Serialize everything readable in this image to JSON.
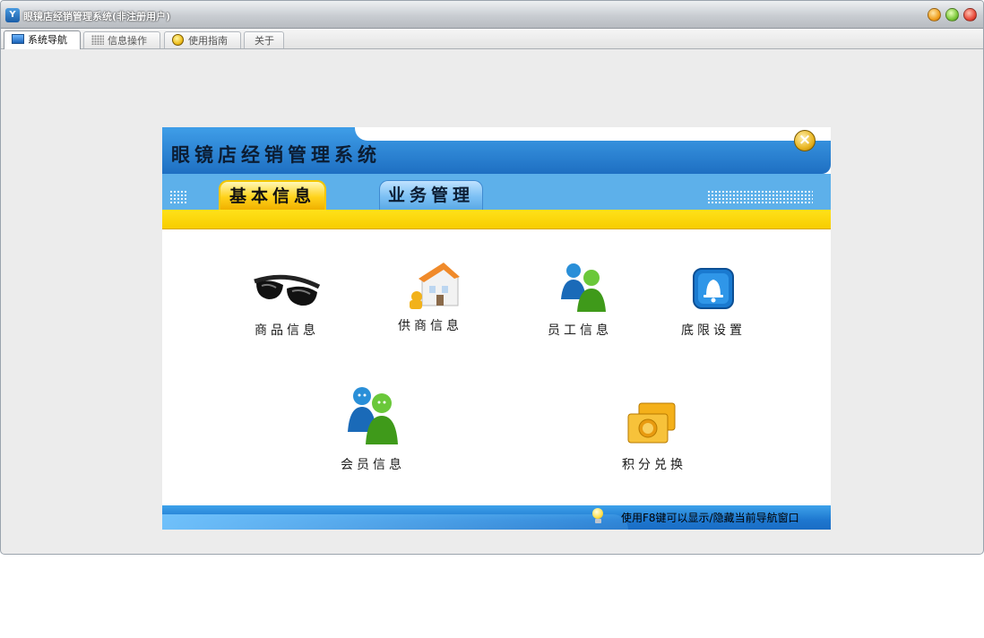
{
  "window": {
    "title": "眼镜店经销管理系统(非注册用户)",
    "app_icon_letter": "Y"
  },
  "tabs": [
    {
      "label": "系统导航",
      "icon": "monitor-icon",
      "active": true
    },
    {
      "label": "信息操作",
      "icon": "grid-icon",
      "active": false
    },
    {
      "label": "使用指南",
      "icon": "help-icon",
      "active": false
    },
    {
      "label": "关于",
      "icon": "",
      "active": false
    }
  ],
  "panel": {
    "title": "眼镜店经销管理系统",
    "close_glyph": "×",
    "tabs": [
      {
        "label": "基本信息",
        "active": true
      },
      {
        "label": "业务管理",
        "active": false
      }
    ],
    "items": [
      {
        "label": "商品信息",
        "icon": "sunglasses-icon"
      },
      {
        "label": "供商信息",
        "icon": "supplier-house-icon"
      },
      {
        "label": "员工信息",
        "icon": "users-icon"
      },
      {
        "label": "底限设置",
        "icon": "bell-icon"
      },
      {
        "label": "会员信息",
        "icon": "members-icon"
      },
      {
        "label": "积分兑换",
        "icon": "coins-icon"
      }
    ],
    "footer_hint": "使用F8键可以显示/隐藏当前导航窗口"
  },
  "colors": {
    "banner_blue": "#1e6fc2",
    "tab_yellow": "#ffd21a",
    "footer_blue": "#1e78d0"
  }
}
